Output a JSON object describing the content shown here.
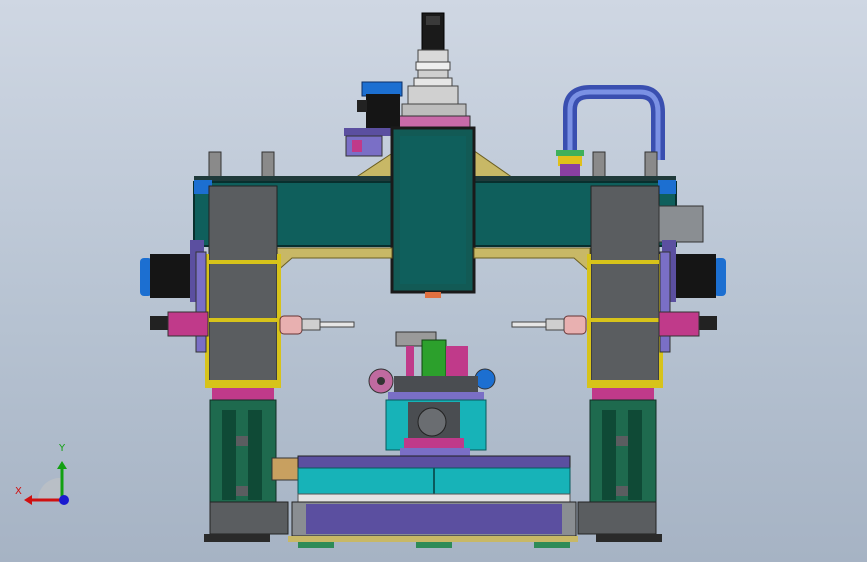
{
  "viewport": {
    "background_top": "#cfd7e3",
    "background_bottom": "#a6b3c4"
  },
  "triad": {
    "x_label": "X",
    "y_label": "Y",
    "x_color": "#d01010",
    "y_color": "#12a012",
    "z_color": "#1a1ad0"
  },
  "colors": {
    "beam_teal": "#0f5f5c",
    "column_gray": "#5a5d60",
    "base_green": "#1e6a4e",
    "yellow_outline": "#d7c31a",
    "motor_blue": "#1c6fd1",
    "motor_black": "#151515",
    "pipe_blue": "#4b63c8",
    "spindle_magenta": "#c03a8a",
    "cyan_cover": "#17b3b8",
    "purple_table": "#5b4fa0"
  }
}
